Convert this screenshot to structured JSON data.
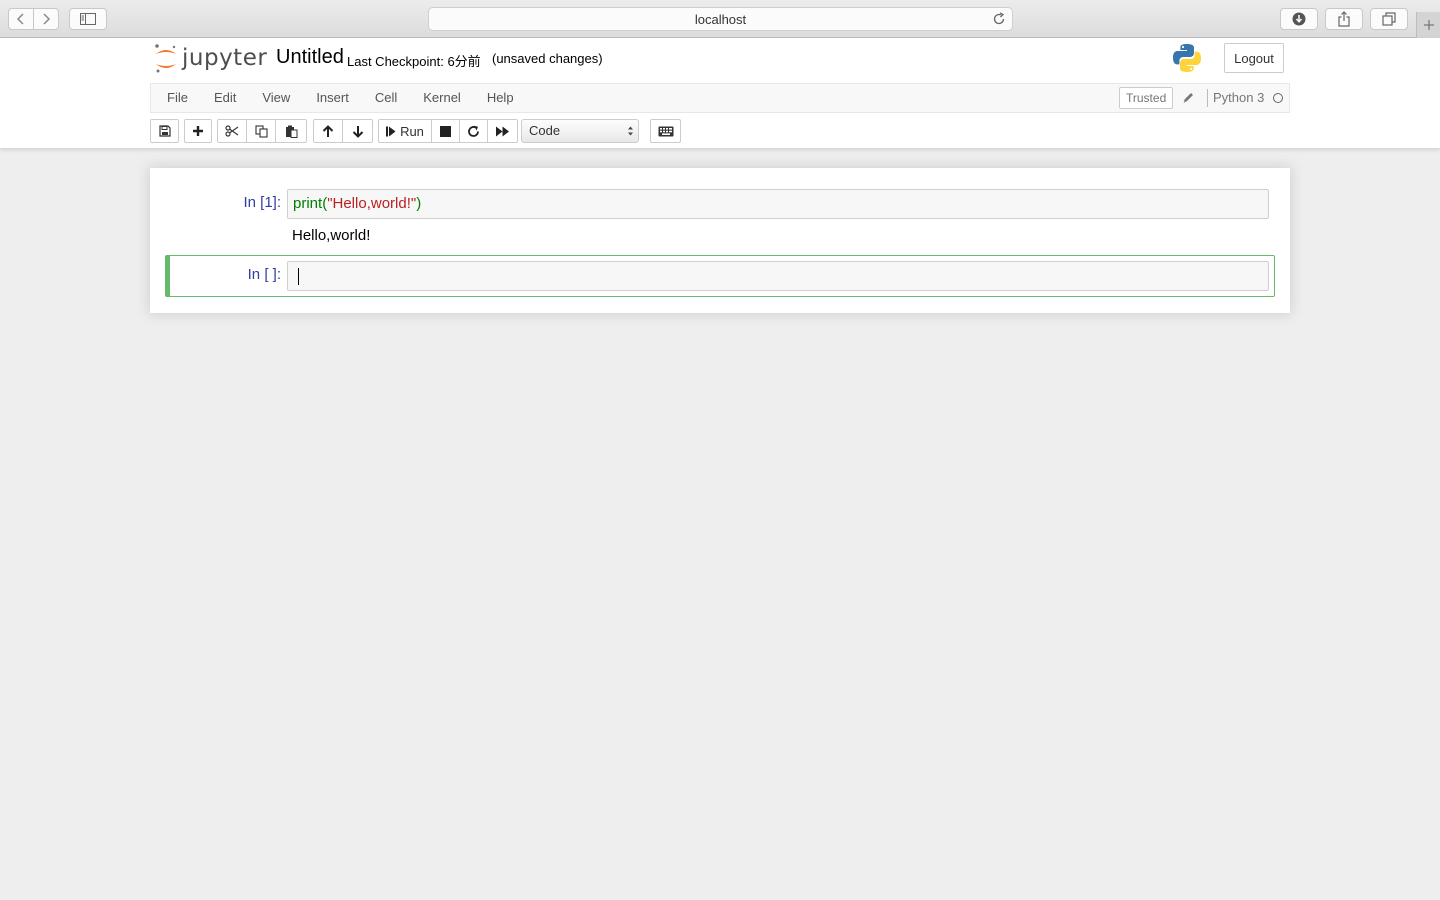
{
  "browser": {
    "url": "localhost",
    "back_icon": "chevron-left-icon",
    "forward_icon": "chevron-right-icon",
    "sidebar_icon": "sidebar-icon",
    "reload_icon": "reload-icon",
    "download_icon": "download-icon",
    "share_icon": "share-icon",
    "tabs_icon": "tabs-icon",
    "new_tab_icon": "plus-icon"
  },
  "header": {
    "logo_text": "jupyter",
    "notebook_title": "Untitled",
    "checkpoint": "Last Checkpoint: 6分前",
    "autosave_status": "(unsaved changes)",
    "logout_label": "Logout"
  },
  "menu": {
    "items": [
      "File",
      "Edit",
      "View",
      "Insert",
      "Cell",
      "Kernel",
      "Help"
    ],
    "trusted_label": "Trusted",
    "kernel_name": "Python 3"
  },
  "toolbar": {
    "run_label": "Run",
    "cell_type": "Code",
    "icons": [
      "save-icon",
      "plus-icon",
      "cut-icon",
      "copy-icon",
      "paste-icon",
      "arrow-up-icon",
      "arrow-down-icon",
      "step-forward-icon",
      "stop-icon",
      "restart-icon",
      "fast-forward-icon",
      "keyboard-icon"
    ]
  },
  "cells": [
    {
      "prompt": "In [1]:",
      "code": {
        "fn": "print",
        "open": "(",
        "string": "\"Hello,world!\"",
        "close": ")"
      },
      "output": "Hello,world!"
    },
    {
      "prompt": "In [ ]:",
      "code": ""
    }
  ],
  "colors": {
    "prompt": "#303f9f",
    "selected_cell_border": "#66bb6a",
    "code_builtin": "#008000",
    "code_string": "#ba2121"
  }
}
